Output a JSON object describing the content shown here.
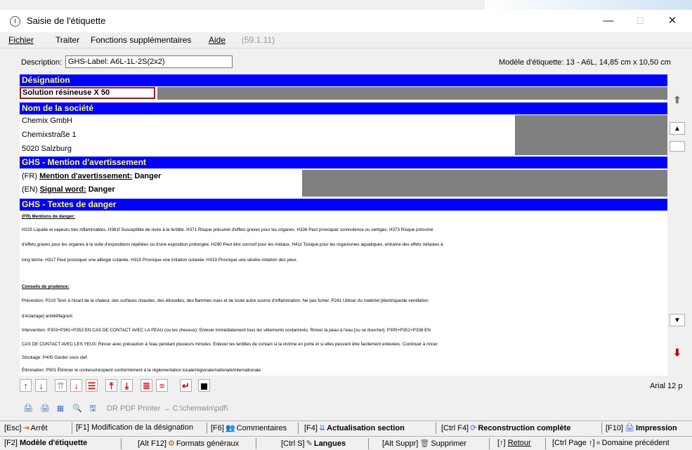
{
  "window": {
    "title": "Saisie de l'étiquette",
    "icon_glyph": "t",
    "minimize_glyph": "—",
    "maximize_glyph": "☐",
    "close_glyph": "✕"
  },
  "menu": [
    {
      "label": "Fichier"
    },
    {
      "label": "Traiter"
    },
    {
      "label": "Fonctions supplémentaires"
    },
    {
      "label": "Aide"
    },
    {
      "label": "(59.1.11)"
    }
  ],
  "description": {
    "label": "Description:",
    "value": "GHS-Label: A6L-1L-2S(2x2)"
  },
  "model_info": "Modèle d'étiquette: 13 - A6L, 14,85 cm x 10,50 cm",
  "sections": {
    "designation": "Désignation",
    "company": "Nom de la société",
    "signal": "GHS - Mention d'avertissement",
    "hazard": "GHS - Textes de danger"
  },
  "designation_value": "Solution résineuse X 50",
  "company_lines": [
    "Chemix GmbH",
    "Chemixstraße 1",
    "5020 Salzburg"
  ],
  "signal": {
    "fr_prefix": "(FR)",
    "fr_label": "Mention d'avertissement:",
    "fr_value": "Danger",
    "en_prefix": "(EN)",
    "en_label": "Signal word:",
    "en_value": "Danger"
  },
  "hazard": {
    "fr_heading": "(FR) Mentions de danger:",
    "h_lines": [
      "H225 Liquide et vapeurs très inflammables. H361f Susceptible de nuire à la fertilité. H371 Risque présumé d'effets graves pour les organes. H336 Peut provoquer somnolence ou vertiges. H373 Risque présumé",
      "d'effets graves pour les organes à la suite d'expositions répétées ou d'une exposition prolongée. H290 Peut être corrosif pour les métaux. H411 Toxique pour les organismes aquatiques, entraîne des effets néfastes à",
      "long terme. H317 Peut provoquer une allergie cutanée. H315 Provoque une irritation cutanée. H319 Provoque une sévère irritation des yeux."
    ],
    "p_heading": "Conseils de prudence:",
    "prevention": "Prévention: P210 Tenir à l'écart de la chaleur, des surfaces chaudes, des étincelles, des flammes nues et de toute autre source d'inflammation. Ne pas fumer. P241 Utiliser du matériel [électrique/de ventilation",
    "prevention_cont": "d'éclairage] antidéflagrant.",
    "intervention": "Intervention: P303+P361+P353 EN CAS DE CONTACT AVEC LA PEAU (ou les cheveux): Enlever immédiatement tous les vêtements contaminés. Rincer la peau à l'eau [ou se doucher]. P305+P351+P338 EN",
    "intervention_cont": "CAS DE CONTACT AVEC LES YEUX: Rincer avec précaution à l'eau pendant plusieurs minutes. Enlever les lentilles de contact si la victime en porte et si elles peuvent être facilement enlevées. Continuer à rincer.",
    "storage": "Stockage: P405 Garder sous clef.",
    "elimination": "Élimination: P501 Éliminer le contenu/récipient conformément à la réglementation locale/régionale/nationale/internationale."
  },
  "scroll_glyphs": {
    "top": "⬆",
    "up": "▲",
    "down": "▼",
    "bottom": "⬇"
  },
  "editor_toolbar": {
    "buttons": [
      {
        "name": "move-up-button",
        "glyph": "↑"
      },
      {
        "name": "move-down-button",
        "glyph": "↓"
      },
      {
        "name": "align-top-button",
        "glyph": "⇈"
      },
      {
        "name": "justify-down-button",
        "glyph": "↓"
      },
      {
        "name": "align-lines-button",
        "glyph": "☰"
      },
      {
        "name": "insert-top-button",
        "glyph": "⤒"
      },
      {
        "name": "insert-bottom-button",
        "glyph": "⤓"
      },
      {
        "name": "paragraph-button",
        "glyph": "≣"
      },
      {
        "name": "format-button",
        "glyph": "≡"
      },
      {
        "name": "return-button",
        "glyph": "↵"
      },
      {
        "name": "image-button",
        "glyph": "◼"
      }
    ],
    "font": "Arial 12 p"
  },
  "print_toolbar": {
    "icons": [
      "🖨",
      "🖨",
      "▦",
      "🔍",
      "🖫"
    ],
    "printer": "DR PDF Printer → C:\\chemwin\\pdf\\"
  },
  "fkeys_row1": [
    {
      "key": "[Esc]",
      "icon": "⇥",
      "label": "Arrêt",
      "bold": false
    },
    {
      "key": "[F1]",
      "icon": "",
      "label": "Modification de la désignation",
      "bold": false
    },
    {
      "key": "[F6]",
      "icon": "👥",
      "label": "Commentaires",
      "bold": false
    },
    {
      "key": "[F4]",
      "icon": "⇊",
      "label": "Actualisation section",
      "bold": true
    },
    {
      "key": "[Ctrl F4]",
      "icon": "⟳",
      "label": "Reconstruction complète",
      "bold": true
    },
    {
      "key": "[F10]",
      "icon": "🖨",
      "label": "Impression",
      "bold": true
    }
  ],
  "fkeys_row2": [
    {
      "key": "[F2]",
      "icon": "",
      "label": "Modèle d'étiquette",
      "bold": true
    },
    {
      "key": "[Alt F12]",
      "icon": "⚙",
      "label": "Formats généraux",
      "bold": false
    },
    {
      "key": "[Ctrl S]",
      "icon": "✎",
      "label": "Langues",
      "bold": true
    },
    {
      "key": "[Alt Suppr]",
      "icon": "🗑",
      "label": "Supprimer",
      "bold": false
    },
    {
      "key": "[↑]",
      "icon": "",
      "label": "Retour",
      "bold": false
    },
    {
      "key": "[Ctrl Page ↑]",
      "icon": "«",
      "label": "Domaine précédent",
      "bold": false
    }
  ]
}
